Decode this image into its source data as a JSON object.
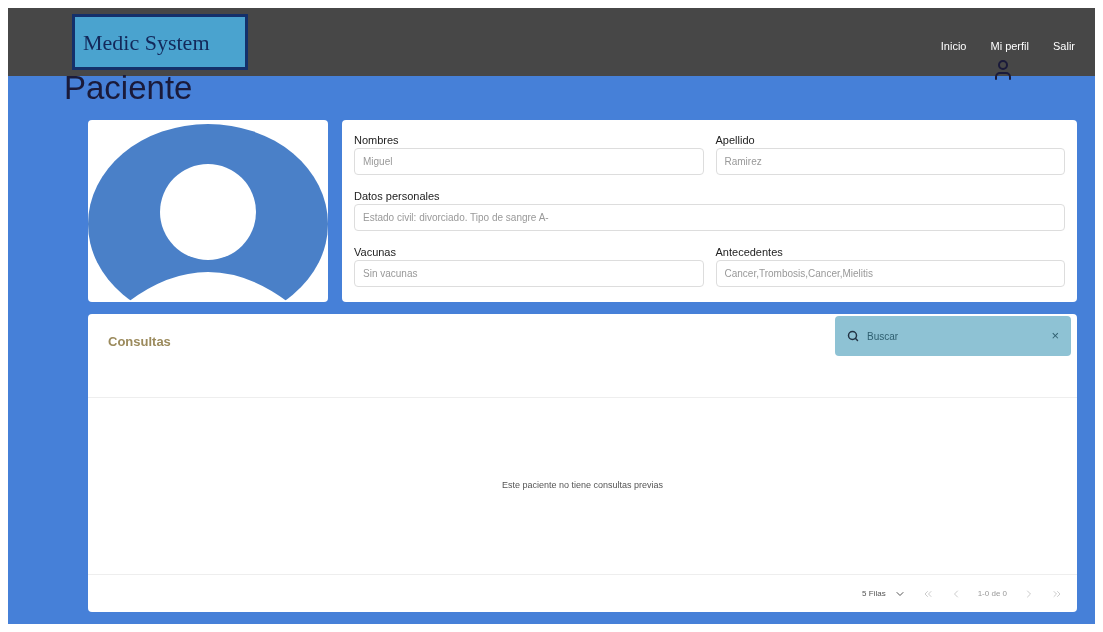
{
  "header": {
    "logo": "Medic System",
    "nav": [
      {
        "label": "Inicio"
      },
      {
        "label": "Mi perfil"
      },
      {
        "label": "Salir"
      }
    ]
  },
  "page_title": "Paciente",
  "form": {
    "rows": [
      [
        {
          "label": "Nombres",
          "placeholder": "Miguel"
        },
        {
          "label": "Apellido",
          "placeholder": "Ramirez"
        }
      ],
      [
        {
          "label": "Datos personales",
          "placeholder": "Estado civil: divorciado. Tipo de sangre A-"
        }
      ],
      [
        {
          "label": "Vacunas",
          "placeholder": "Sin vacunas"
        },
        {
          "label": "Antecedentes",
          "placeholder": "Cancer,Trombosis,Cancer,Mielitis"
        }
      ]
    ]
  },
  "consultas": {
    "title": "Consultas",
    "search": {
      "placeholder": "Buscar",
      "clear": "×"
    },
    "empty_message": "Este paciente no tiene consultas previas",
    "pagination": {
      "rows": "5 Filas",
      "range": "1-0 de 0"
    }
  }
}
